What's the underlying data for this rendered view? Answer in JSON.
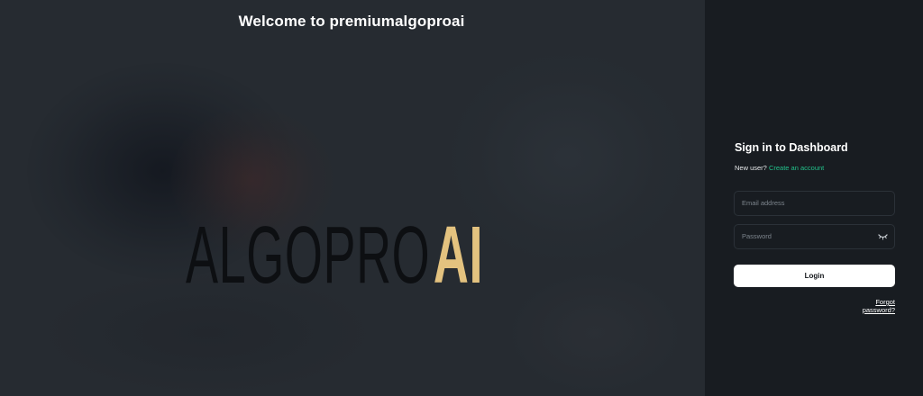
{
  "hero": {
    "welcome": "Welcome to premiumalgoproai",
    "logo": {
      "primary": "ALGOPRO",
      "accent": "AI",
      "accent_color": "#e3c27f"
    }
  },
  "signin": {
    "title": "Sign in to Dashboard",
    "new_user": "New user?",
    "create_account": "Create an account",
    "email_placeholder": "Email address",
    "password_placeholder": "Password",
    "password_toggle_icon": "eye-closed-icon",
    "login": "Login",
    "forgot": "Forgot password?"
  },
  "colors": {
    "link": "#22c08a",
    "panel_bg": "#181c21",
    "hero_bg": "#262b31"
  }
}
